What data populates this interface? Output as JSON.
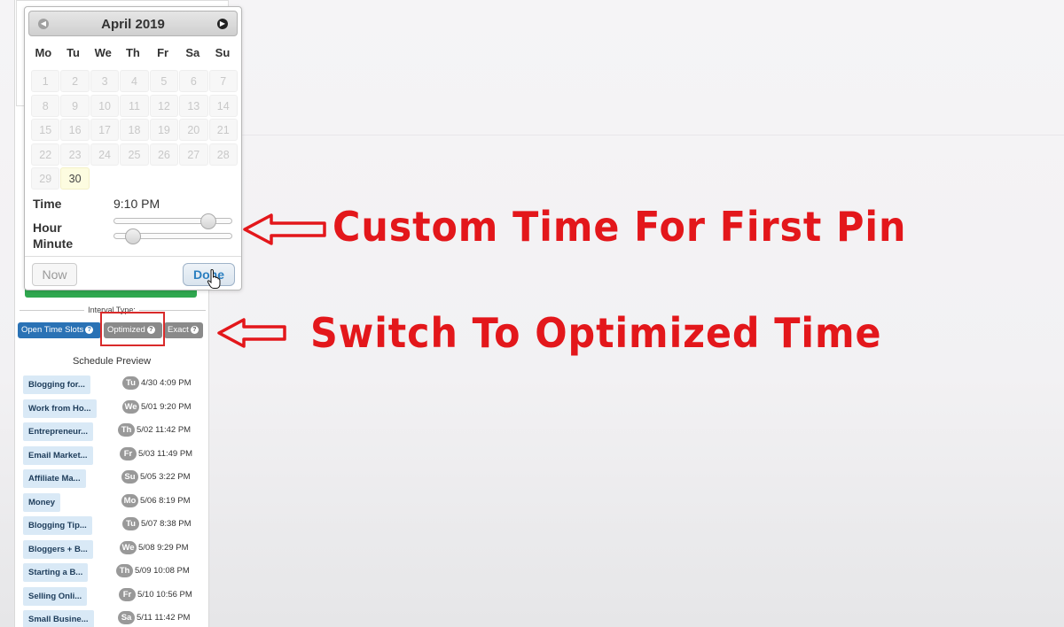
{
  "datepicker": {
    "month_title": "April 2019",
    "weekdays": [
      "Mo",
      "Tu",
      "We",
      "Th",
      "Fr",
      "Sa",
      "Su"
    ],
    "weeks": [
      [
        "1",
        "2",
        "3",
        "4",
        "5",
        "6",
        "7"
      ],
      [
        "8",
        "9",
        "10",
        "11",
        "12",
        "13",
        "14"
      ],
      [
        "15",
        "16",
        "17",
        "18",
        "19",
        "20",
        "21"
      ],
      [
        "22",
        "23",
        "24",
        "25",
        "26",
        "27",
        "28"
      ],
      [
        "29",
        "30",
        "",
        "",
        "",
        "",
        ""
      ]
    ],
    "time_label": "Time",
    "time_value": "9:10 PM",
    "hour_label": "Hour",
    "minute_label": "Minute",
    "hour_slider_fraction": 0.84,
    "minute_slider_fraction": 0.1,
    "now_label": "Now",
    "done_label": "Done"
  },
  "interval": {
    "label": "Interval Type:",
    "options": [
      "Open Time Slots",
      "Optimized",
      "Exact"
    ],
    "selected": "Open Time Slots"
  },
  "schedule_preview": {
    "title": "Schedule Preview",
    "items": [
      {
        "title": "Blogging for...",
        "day": "Tu",
        "date": "4/30 4:09 PM"
      },
      {
        "title": "Work from Ho...",
        "day": "We",
        "date": "5/01 9:20 PM"
      },
      {
        "title": "Entrepreneur...",
        "day": "Th",
        "date": "5/02 11:42 PM"
      },
      {
        "title": "Email Market...",
        "day": "Fr",
        "date": "5/03 11:49 PM"
      },
      {
        "title": "Affiliate Ma...",
        "day": "Su",
        "date": "5/05 3:22 PM"
      },
      {
        "title": "Money",
        "day": "Mo",
        "date": "5/06 8:19 PM"
      },
      {
        "title": "Blogging Tip...",
        "day": "Tu",
        "date": "5/07 8:38 PM"
      },
      {
        "title": "Bloggers + B...",
        "day": "We",
        "date": "5/08 9:29 PM"
      },
      {
        "title": "Starting a B...",
        "day": "Th",
        "date": "5/09 10:08 PM"
      },
      {
        "title": "Selling Onli...",
        "day": "Fr",
        "date": "5/10 10:56 PM"
      },
      {
        "title": "Small Busine...",
        "day": "Sa",
        "date": "5/11 11:42 PM"
      }
    ]
  },
  "annotations": {
    "custom_time": "Custom Time For First Pin",
    "switch_optimized": "Switch To Optimized Time",
    "color": "#e3171b"
  }
}
